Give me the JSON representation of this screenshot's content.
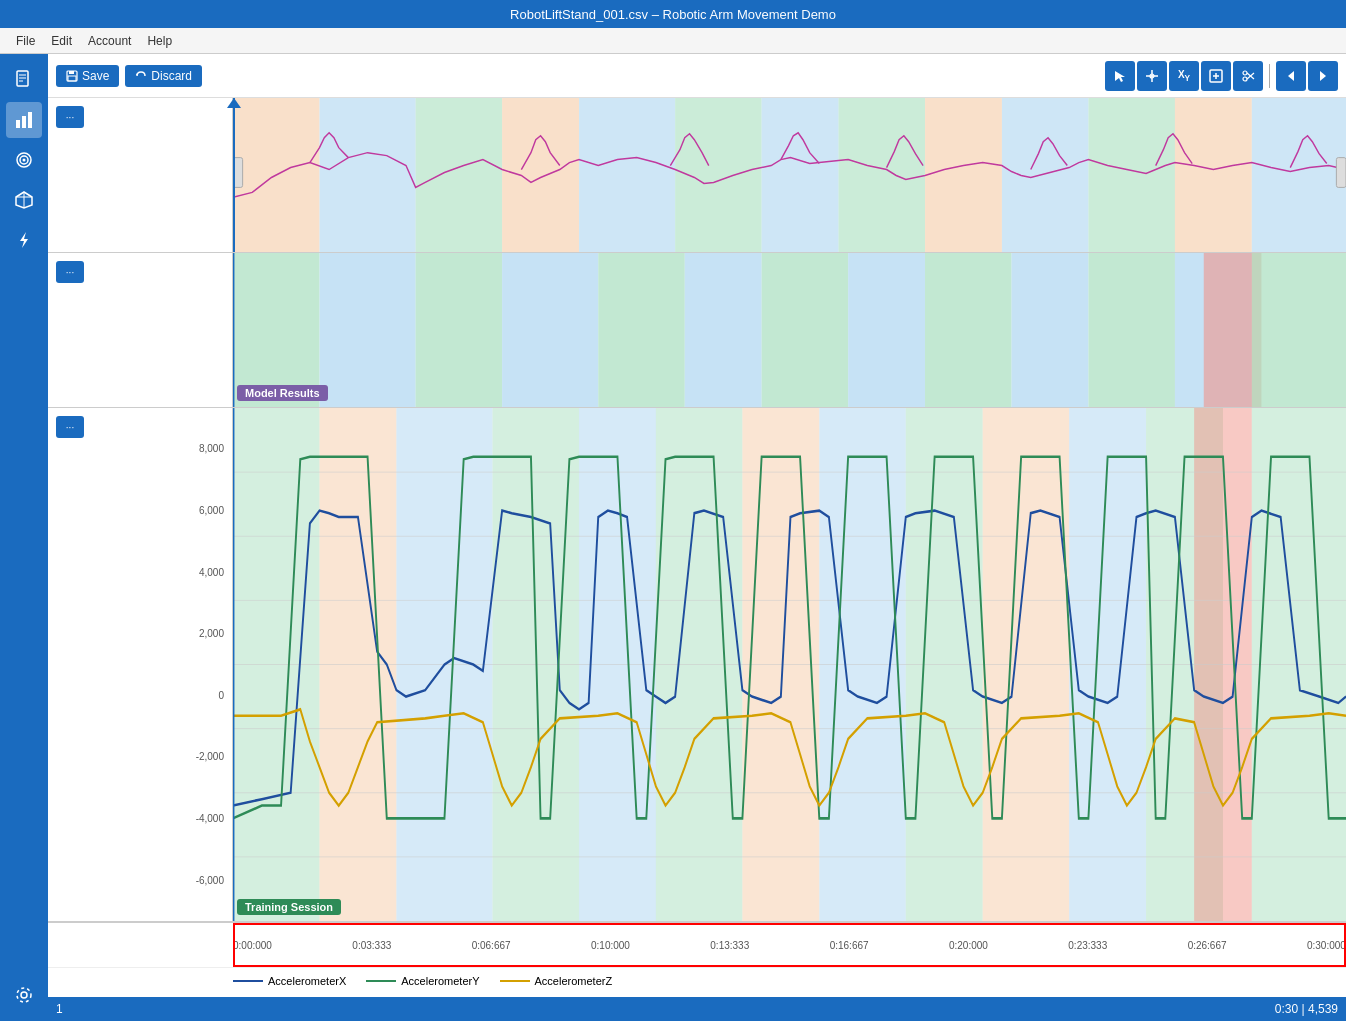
{
  "titleBar": {
    "text": "RobotLiftStand_001.csv – Robotic Arm Movement Demo"
  },
  "menuBar": {
    "items": [
      "File",
      "Edit",
      "Account",
      "Help"
    ]
  },
  "toolbar": {
    "saveLabel": "Save",
    "discardLabel": "Discard"
  },
  "sidebar": {
    "icons": [
      {
        "name": "document-icon",
        "symbol": "📄"
      },
      {
        "name": "chart-icon",
        "symbol": "📊"
      },
      {
        "name": "signal-icon",
        "symbol": "〰"
      },
      {
        "name": "cube-icon",
        "symbol": "⬡"
      },
      {
        "name": "lightning-icon",
        "symbol": "⚡"
      }
    ],
    "bottomIcon": {
      "name": "settings-icon",
      "symbol": "⚙"
    }
  },
  "charts": {
    "chart1": {
      "label": null,
      "type": "signal"
    },
    "chart2": {
      "label": "Model Results",
      "badgeClass": "badge-model"
    },
    "chart3": {
      "label": "Training Session",
      "badgeClass": "badge-training",
      "yAxis": {
        "values": [
          "8,000",
          "6,000",
          "4,000",
          "2,000",
          "0",
          "-2,000",
          "-4,000",
          "-6,000"
        ]
      }
    }
  },
  "timeline": {
    "ticks": [
      "0:00:000",
      "0:03:333",
      "0:06:667",
      "0:10:000",
      "0:13:333",
      "0:16:667",
      "0:20:000",
      "0:23:333",
      "0:26:667",
      "0:30:000"
    ]
  },
  "legend": {
    "items": [
      {
        "label": "AccelerometerX",
        "color": "#1f4e9e"
      },
      {
        "label": "AccelerometerY",
        "color": "#2e8b57"
      },
      {
        "label": "AccelerometerZ",
        "color": "#d4a000"
      }
    ]
  },
  "statusBar": {
    "left": "1",
    "right": "0:30 | 4,539"
  },
  "redBox": {
    "description": "selection box around timeline"
  }
}
